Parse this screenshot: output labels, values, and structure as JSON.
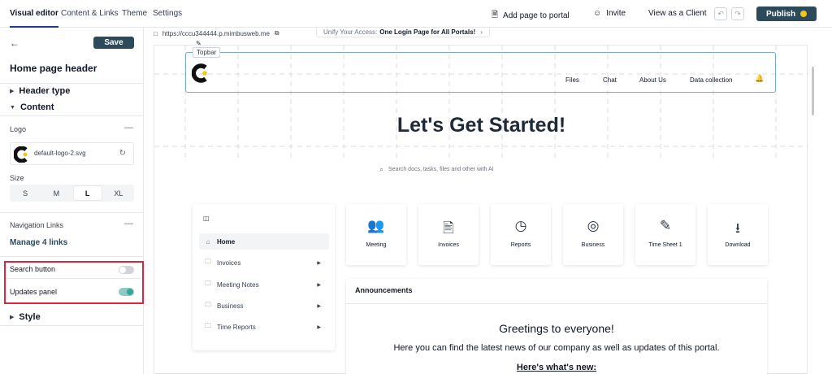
{
  "topnav": {
    "tabs": [
      {
        "label": "Visual editor",
        "active": true
      },
      {
        "label": "Content & Links",
        "active": false
      },
      {
        "label": "Theme",
        "active": false
      },
      {
        "label": "Settings",
        "active": false
      }
    ],
    "add_page": "Add page to portal",
    "invite": "Invite",
    "view_as_client": "View as a Client",
    "publish": "Publish"
  },
  "sidebar": {
    "save": "Save",
    "title": "Home page header",
    "header_type": "Header type",
    "content": "Content",
    "logo_label": "Logo",
    "logo_file": "default-logo-2.svg",
    "size_label": "Size",
    "sizes": [
      "S",
      "M",
      "L",
      "XL"
    ],
    "size_selected": "L",
    "nav_links_label": "Navigation Links",
    "manage_links": "Manage 4 links",
    "search_button": "Search button",
    "search_button_on": false,
    "updates_panel": "Updates panel",
    "updates_panel_on": true,
    "style": "Style"
  },
  "preview": {
    "url": "https://cccu344444.p.mimbusweb.me",
    "tab_text": "Unify Your Access:",
    "tab_text_bold": "One Login Page for All Portals!",
    "topbar_tag": "Topbar",
    "nav_links": [
      "Files",
      "Chat",
      "About Us",
      "Data collection"
    ],
    "hero": "Let's Get Started!",
    "search_placeholder": "Search docs, tasks, files and other with AI",
    "nav_items": [
      {
        "label": "Home",
        "active": true
      },
      {
        "label": "Invoices"
      },
      {
        "label": "Meeting Notes"
      },
      {
        "label": "Business"
      },
      {
        "label": "Time Reports"
      }
    ],
    "tiles": [
      {
        "label": "Meeting",
        "icon": "users-icon"
      },
      {
        "label": "Invoices",
        "icon": "invoice-icon"
      },
      {
        "label": "Reports",
        "icon": "clock-icon"
      },
      {
        "label": "Business",
        "icon": "target-icon"
      },
      {
        "label": "Time Sheet 1",
        "icon": "pencil-icon"
      },
      {
        "label": "Download",
        "icon": "file-download-icon"
      }
    ],
    "announcements": {
      "title": "Announcements",
      "heading": "Greetings to everyone!",
      "body": "Here you can find the latest news of our company as well as updates of this portal.",
      "link": "Here's what's new:"
    }
  },
  "colors": {
    "accent": "#2d4a5a",
    "highlight": "#dc2640",
    "topbar_border": "#7aa9d8",
    "toggle_on": "#3aa59c"
  }
}
